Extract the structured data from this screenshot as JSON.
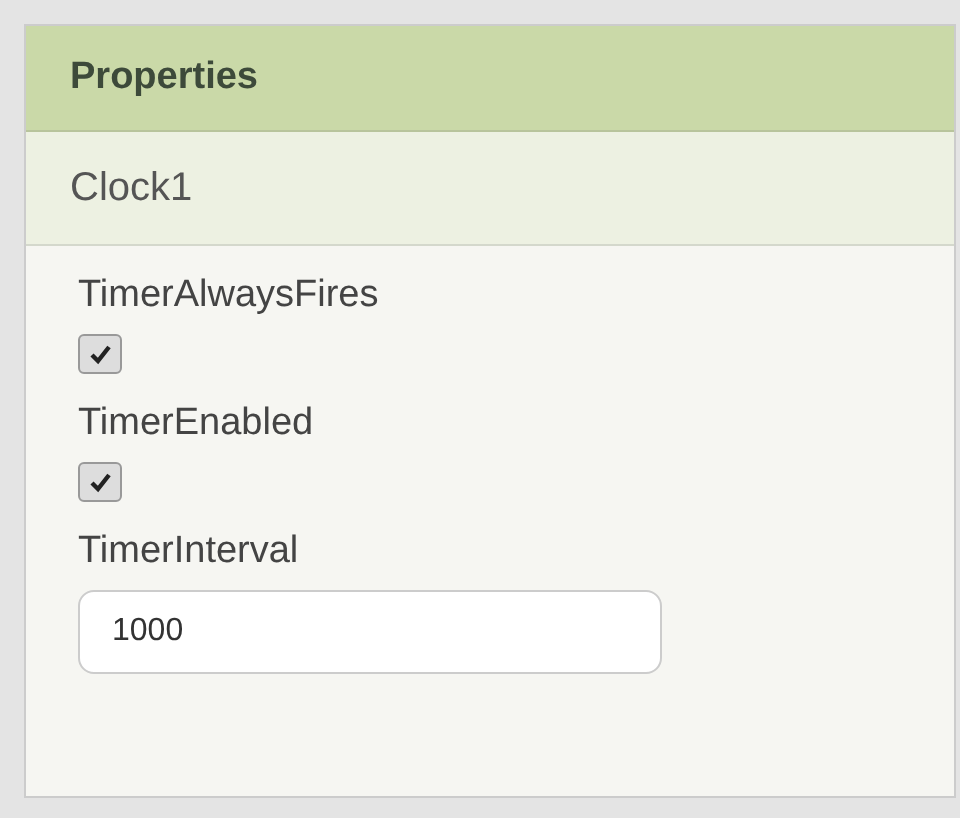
{
  "panel": {
    "title": "Properties",
    "component": "Clock1"
  },
  "properties": [
    {
      "kind": "checkbox",
      "label": "TimerAlwaysFires",
      "checked": true
    },
    {
      "kind": "checkbox",
      "label": "TimerEnabled",
      "checked": true
    },
    {
      "kind": "textbox",
      "label": "TimerInterval",
      "value": "1000"
    }
  ]
}
